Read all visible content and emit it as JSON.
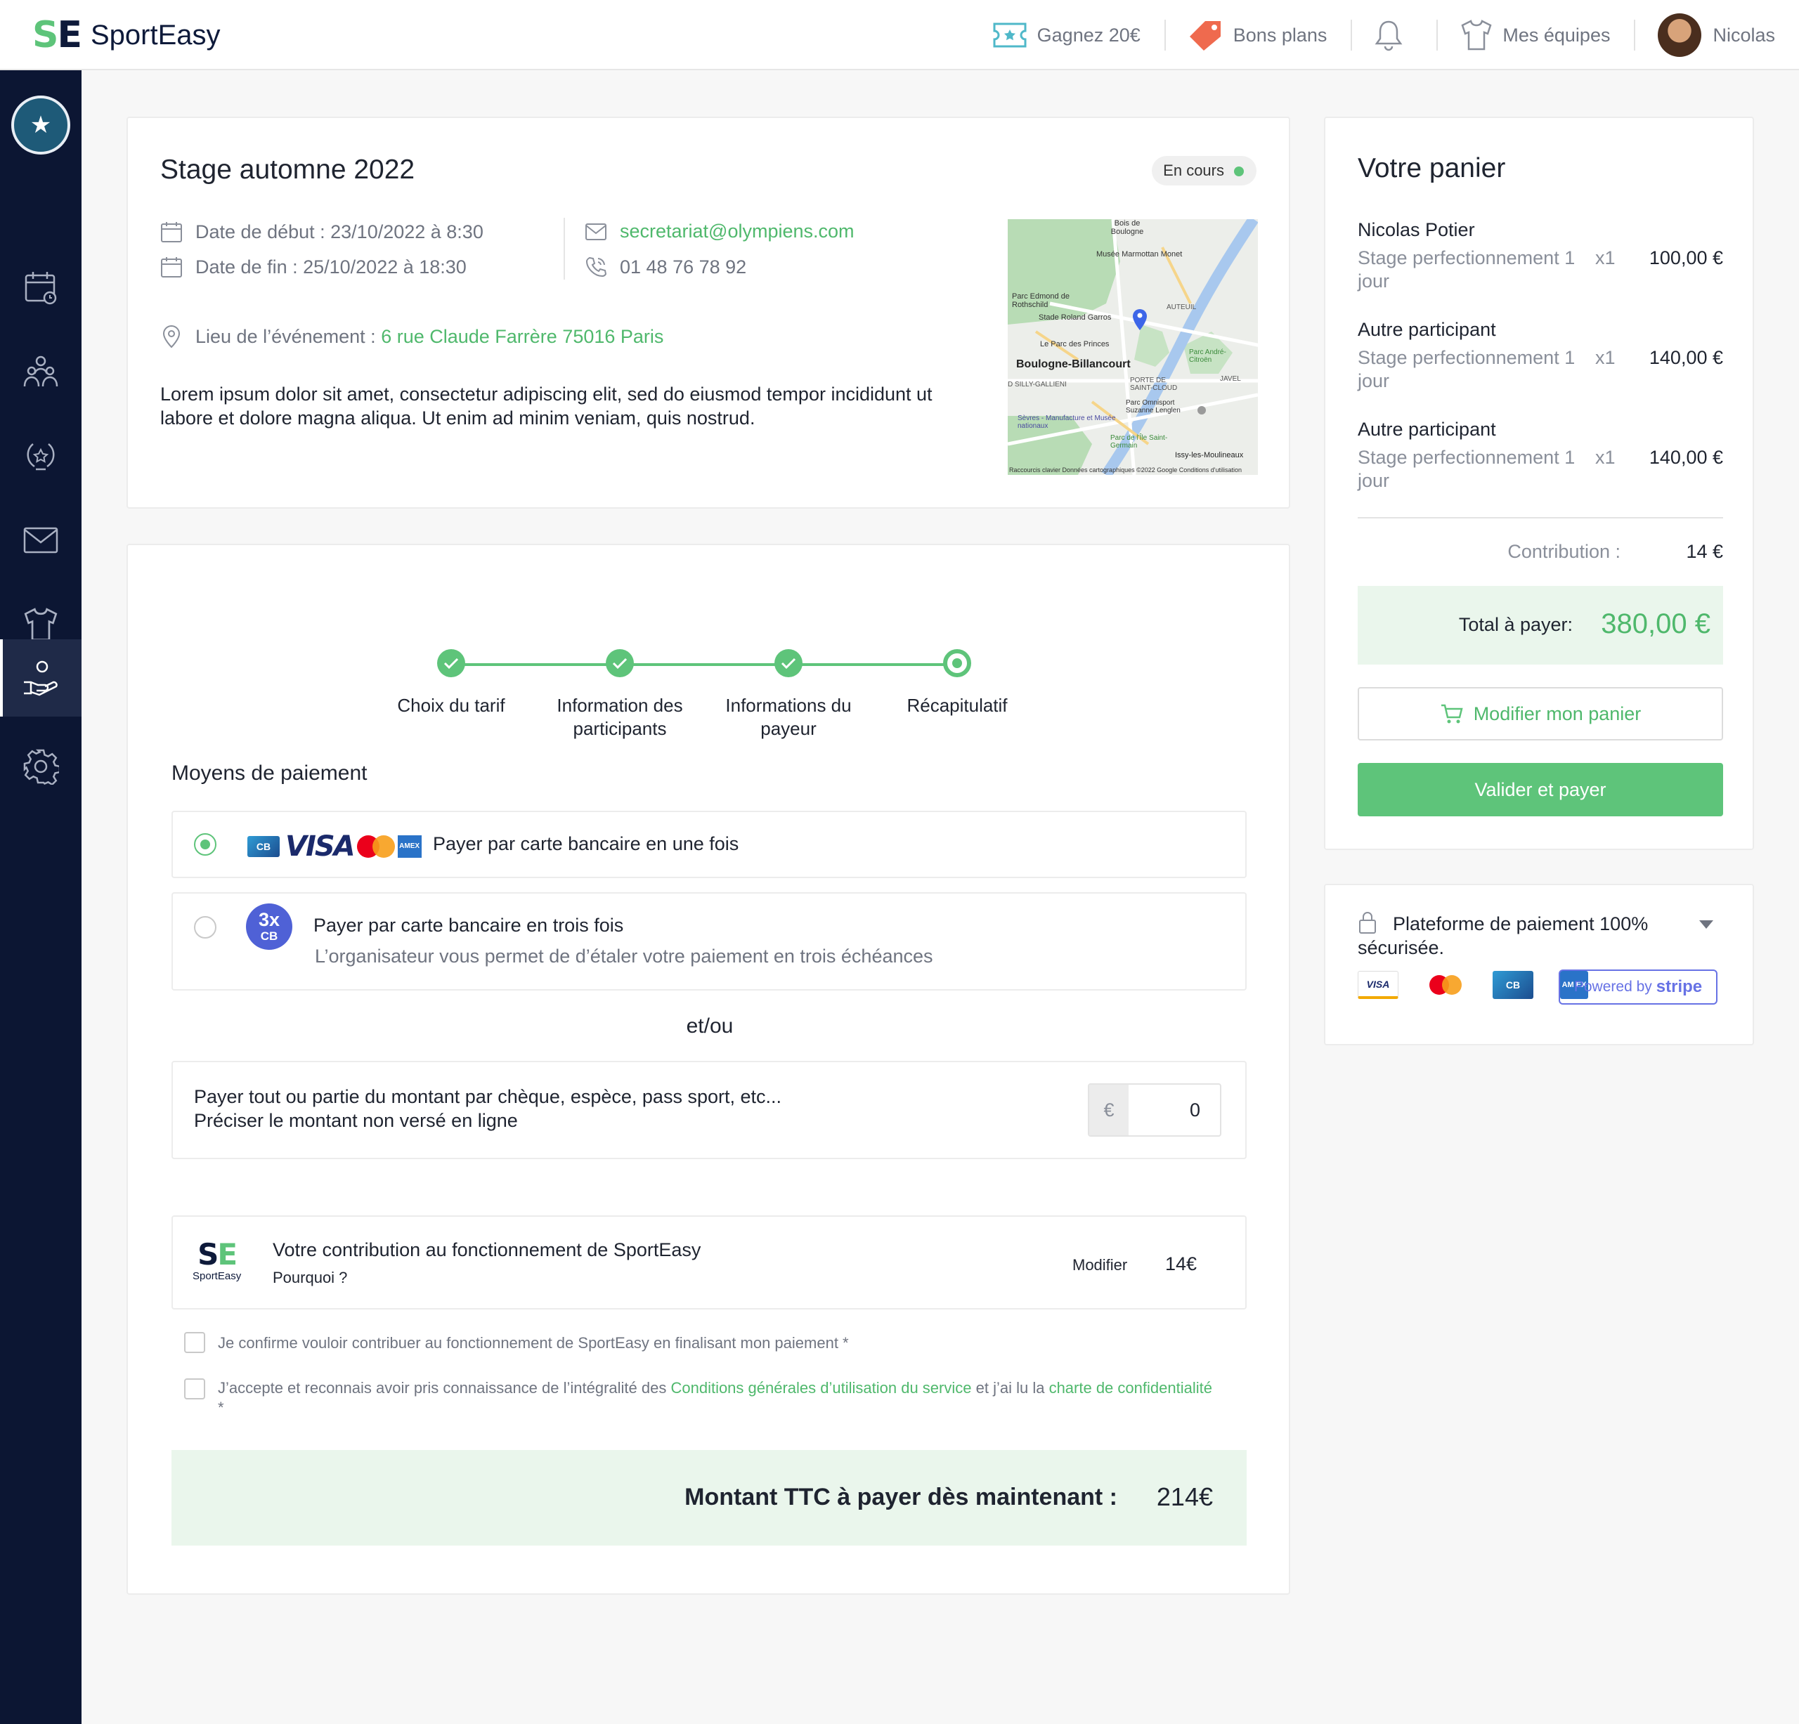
{
  "brand": {
    "logo_s": "S",
    "logo_e": "E",
    "name": "SportEasy"
  },
  "topnav": {
    "referral": "Gagnez 20€",
    "deals": "Bons plans",
    "teams": "Mes équipes",
    "user": "Nicolas"
  },
  "sidebar": {
    "club_initial": "★"
  },
  "event": {
    "title": "Stage automne 2022",
    "status": "En cours",
    "start_label": "Date de début : 23/10/2022 à 8:30",
    "end_label": "Date de fin : 25/10/2022 à 18:30",
    "email": "secretariat@olympiens.com",
    "phone": "01 48 76 78 92",
    "location_label": "Lieu de l’événement :",
    "location": "6 rue Claude Farrère 75016 Paris",
    "description": "Lorem ipsum dolor sit amet, consectetur adipiscing elit, sed do eiusmod tempor incididunt ut labore et dolore magna aliqua. Ut enim ad minim veniam, quis nostrud.",
    "map": {
      "labels": [
        "Bois de Boulogne",
        "Musée Marmottan Monet",
        "Parc Edmond de Rothschild",
        "Stade Roland Garros",
        "AUTEUIL",
        "Le Parc des Princes",
        "Boulogne-Billancourt",
        "PORTE DE SAINT-CLOUD",
        "Parc Omnisport Suzanne Lenglen",
        "JAVEL",
        "Parc André-Citroën",
        "Sèvres - Manufacture et Musée nationaux",
        "Parc de l’Île Saint-Germain",
        "Issy-les-Moulineaux",
        "D SILLY-GALLIENI"
      ],
      "footer": "Raccourcis clavier   Données cartographiques ©2022 Google   Conditions d'utilisation"
    }
  },
  "steps": [
    {
      "label": "Choix du tarif"
    },
    {
      "label": "Information des participants"
    },
    {
      "label": "Informations du payeur"
    },
    {
      "label": "Récapitulatif"
    }
  ],
  "payment": {
    "section_title": "Moyens de paiement",
    "once_label": "Payer par carte bancaire en une fois",
    "card_logos": {
      "cb": "CB",
      "visa": "VISA",
      "amex": "AMEX"
    },
    "three_x": {
      "top": "3x",
      "bottom": "CB"
    },
    "three_label": "Payer par carte bancaire en trois fois",
    "three_sub": "L’organisateur vous permet de d’étaler votre paiement en trois échéances",
    "andor": "et/ou",
    "other_line1": "Payer tout ou partie du montant par chèque, espèce, pass sport, etc...",
    "other_line2": "Préciser le montant non versé en ligne",
    "currency": "€",
    "other_amount": "0"
  },
  "contribution": {
    "logo_text": "SportEasy",
    "title": "Votre contribution au fonctionnement de SportEasy",
    "why": "Pourquoi ?",
    "edit": "Modifier",
    "amount": "14€"
  },
  "consent": {
    "c1": "Je confirme vouloir contribuer au fonctionnement de SportEasy en finalisant mon paiement *",
    "c2_a": "J’accepte et reconnais avoir pris connaissance de l’intégralité des ",
    "c2_link1": "Conditions générales d’utilisation du service",
    "c2_b": " et j’ai lu la ",
    "c2_link2": "charte de confidentialité",
    "c2_c": " *"
  },
  "total_now": {
    "label": "Montant TTC à payer dès maintenant :",
    "value": "214€"
  },
  "cart": {
    "title": "Votre panier",
    "items": [
      {
        "name": "Nicolas Potier",
        "product": "Stage perfectionnement 1 jour",
        "qty": "x1",
        "price": "100,00 €"
      },
      {
        "name": "Autre participant",
        "product": "Stage perfectionnement 1 jour",
        "qty": "x1",
        "price": "140,00 €"
      },
      {
        "name": "Autre participant",
        "product": "Stage perfectionnement 1 jour",
        "qty": "x1",
        "price": "140,00 €"
      }
    ],
    "contribution_label": "Contribution :",
    "contribution_value": "14 €",
    "total_label": "Total à payer:",
    "total_value": "380,00 €",
    "edit_button": "Modifier mon panier",
    "pay_button": "Valider et payer"
  },
  "secure": {
    "text": "Plateforme de paiement 100% sécurisée.",
    "logos": {
      "visa": "VISA",
      "cb": "CB",
      "amex": "AM EX"
    },
    "powered": "Powered by",
    "stripe": "stripe"
  },
  "colors": {
    "accent": "#5ec47a",
    "navy": "#0c1633",
    "link": "#4fb86c"
  }
}
